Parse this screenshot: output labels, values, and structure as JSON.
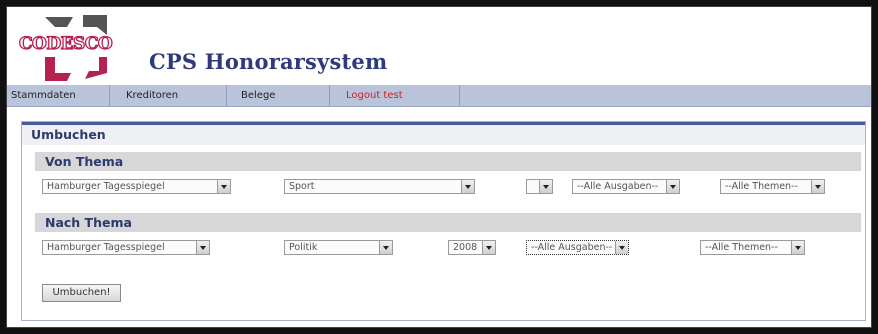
{
  "header": {
    "title": "CPS Honorarsystem",
    "logo_text": "CODESCO"
  },
  "nav": {
    "items": [
      {
        "label": "Stammdaten"
      },
      {
        "label": "Kreditoren"
      },
      {
        "label": "Belege"
      },
      {
        "label": "Logout test"
      }
    ]
  },
  "panel": {
    "title": "Umbuchen",
    "von": {
      "heading": "Von Thema",
      "publication": "Hamburger Tagesspiegel",
      "topic": "Sport",
      "year": "",
      "issues": "--Alle Ausgaben--",
      "themes": "--Alle Themen--"
    },
    "nach": {
      "heading": "Nach Thema",
      "publication": "Hamburger Tagesspiegel",
      "topic": "Politik",
      "year": "2008",
      "issues": "--Alle Ausgaben--",
      "themes": "--Alle Themen--"
    },
    "submit_label": "Umbuchen!"
  },
  "colors": {
    "title": "#2e3a7a",
    "nav_bg": "#b9c3da",
    "logout": "#c0282d",
    "logo_magenta": "#b5224f"
  }
}
